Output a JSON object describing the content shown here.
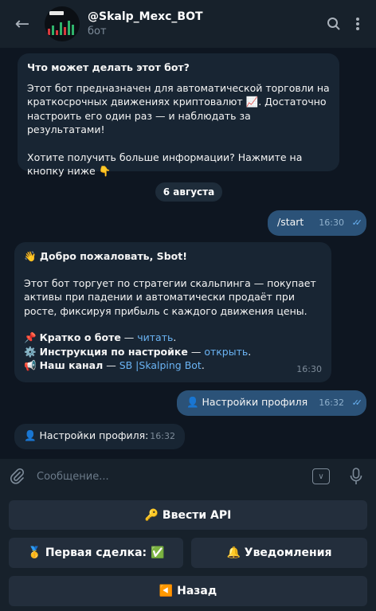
{
  "header": {
    "back_icon": "arrow-left-icon",
    "title": "@Skalp_Mexc_BOT",
    "subtitle": "бот",
    "search_icon": "search-icon",
    "menu_icon": "more-vertical-icon"
  },
  "intro": {
    "heading": "Что может делать этот бот?",
    "line1": "Этот бот предназначен для автоматической торговли на краткосрочных движениях криптовалют 📈. Достаточно настроить его один раз — и наблюдать за результатами!",
    "line2": "Хотите получить больше информации? Нажмите на кнопку ниже 👇"
  },
  "date_separator": "6 августа",
  "messages": [
    {
      "text": "/start",
      "time": "16:30"
    },
    {
      "greeting": "👋 Добро пожаловать, Sbot!",
      "body": "Этот бот торгует по стратегии скальпинга — покупает активы при падении и автоматически продаёт при росте, фиксируя прибыль с каждого движения цены.",
      "items": [
        {
          "emoji": "📌",
          "label": "Кратко о боте",
          "sep": " — ",
          "link": "читать",
          "end": "."
        },
        {
          "emoji": "⚙️",
          "label": "Инструкция по настройке",
          "sep": " — ",
          "link": "открыть",
          "end": "."
        },
        {
          "emoji": "📢",
          "label": "Наш канал",
          "sep": " — ",
          "link": "SB |Skalping Bot",
          "end": "."
        }
      ],
      "time": "16:30"
    },
    {
      "text": "👤 Настройки профиля",
      "time": "16:32"
    },
    {
      "text": "👤 Настройки профиля:",
      "time": "16:32"
    }
  ],
  "composer": {
    "placeholder": "Сообщение...",
    "attach_icon": "paperclip-icon",
    "keyboard_icon": "keyboard-toggle-icon",
    "mic_icon": "microphone-icon"
  },
  "keyboard": {
    "api": "🔑 Ввести API",
    "first_deal": "🥇 Первая сделка: ✅",
    "notifications": "🔔 Уведомления",
    "back": "◀️ Назад"
  },
  "colors": {
    "background": "#0e1621",
    "panel": "#17212b",
    "incoming_bubble": "#182533",
    "outgoing_bubble": "#2b5278",
    "link": "#6ab3f3",
    "button": "#232e3c"
  }
}
